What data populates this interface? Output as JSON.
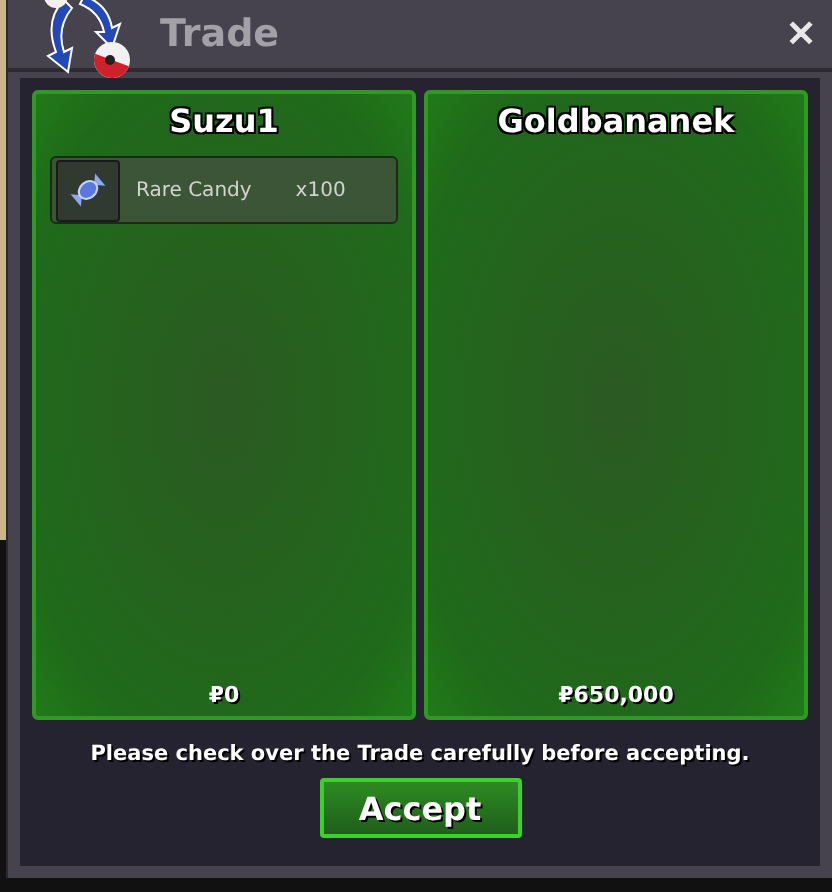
{
  "window": {
    "title": "Trade",
    "close": "✕"
  },
  "panels": [
    {
      "name": "Suzu1",
      "items": [
        {
          "name": "Rare Candy",
          "quantity": "x100"
        }
      ],
      "money": "₽0"
    },
    {
      "name": "Goldbananek",
      "money": "₽650,000"
    }
  ],
  "notice": "Please check over the Trade carefully before accepting.",
  "button": "Accept"
}
